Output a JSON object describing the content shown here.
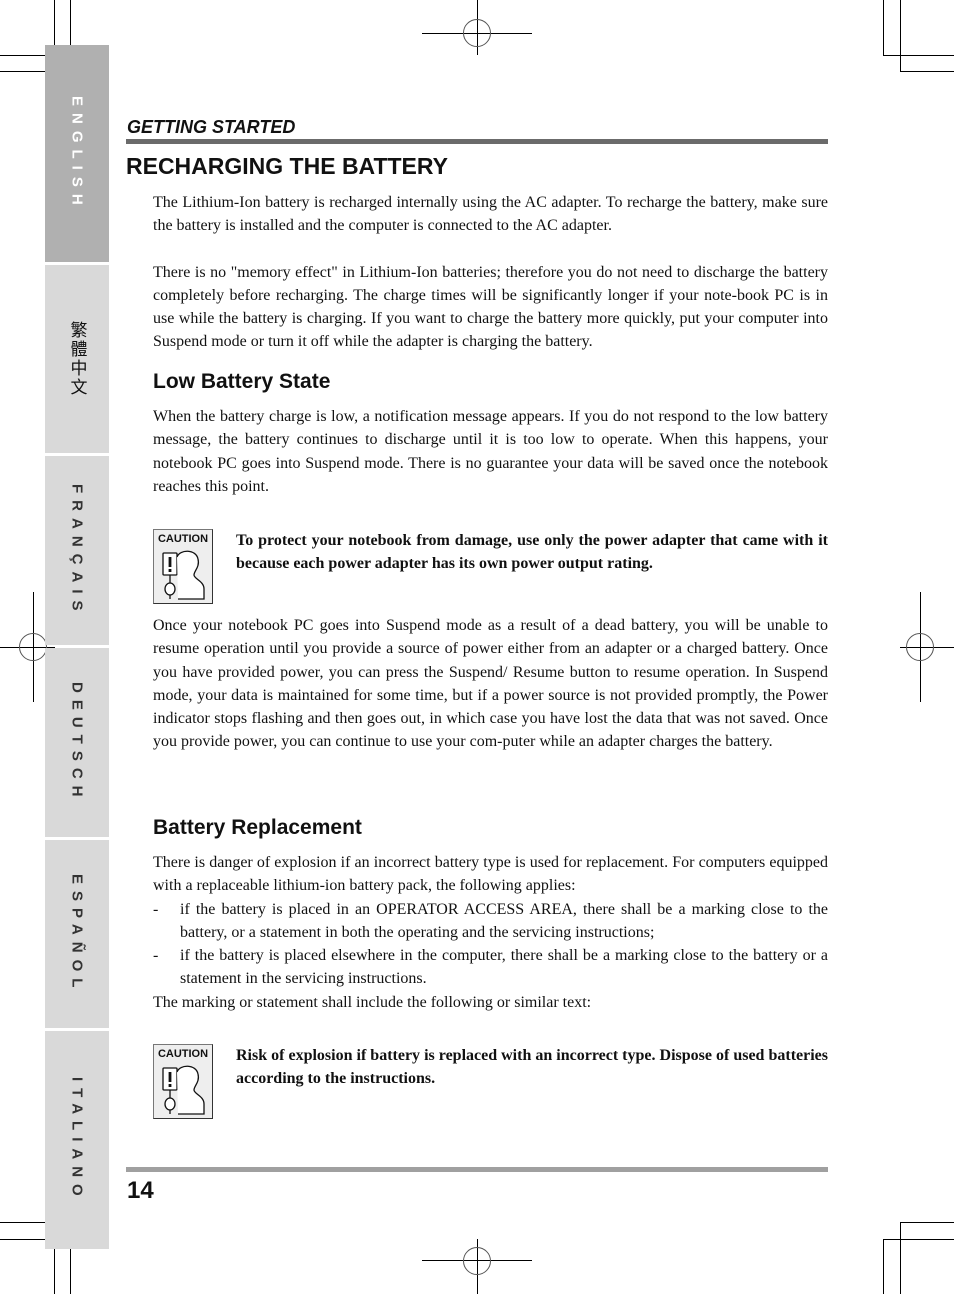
{
  "sidebar": {
    "languages": [
      {
        "label": "ENGLISH",
        "active": true
      },
      {
        "label": "繁體中文",
        "active": false
      },
      {
        "label": "FRANÇAIS",
        "active": false
      },
      {
        "label": "DEUTSCH",
        "active": false
      },
      {
        "label": "ESPAÑOL",
        "active": false
      },
      {
        "label": "ITALIANO",
        "active": false
      }
    ]
  },
  "header": {
    "section": "GETTING STARTED",
    "title": "RECHARGING THE BATTERY"
  },
  "recharging": {
    "paragraphs": [
      "The Lithium-Ion battery is recharged internally using the AC adapter. To recharge the battery, make sure the battery is installed and the computer is connected to the AC adapter.",
      "There is no \"memory effect\" in Lithium-Ion batteries; therefore you do not need to discharge the battery completely before recharging. The charge times will be significantly longer if your note-book PC is in use while the battery is charging. If you want to charge the battery more quickly, put your computer into Suspend mode or turn it off while the adapter is charging the battery."
    ]
  },
  "low_battery": {
    "heading": "Low Battery State",
    "paragraph": "When the battery charge is low, a notification message appears. If you do not respond to the low battery message, the battery continues to discharge until it is too low to operate. When this happens, your notebook PC goes into Suspend mode. There is no guarantee your data will be saved once the notebook reaches this point.",
    "caution": {
      "label": "CAUTION",
      "text": "To protect your notebook from damage, use only the power adapter that came with it because each power adapter has its own power output rating."
    },
    "paragraph2": "Once your notebook PC goes into Suspend mode as a result of a dead battery, you will be unable to resume operation until you provide a source of power either from an adapter or a charged battery. Once you have provided power, you can press the Suspend/ Resume button to resume operation. In Suspend mode, your data is maintained for some time, but if a power source is not provided promptly, the Power indicator stops flashing and then goes out, in which case you have lost the data that was not saved. Once you provide power, you can continue to use your com-puter while an adapter charges the battery."
  },
  "replacement": {
    "heading": "Battery Replacement",
    "intro": "There is danger of explosion if an incorrect battery type is used for replacement. For computers equipped with a replaceable lithium-ion battery pack, the following applies:",
    "bullets": [
      {
        "marker": "-",
        "text": "if the battery is placed in an OPERATOR ACCESS AREA, there shall be a marking close to the battery, or a statement in both the operating and the servicing instructions;"
      },
      {
        "marker": "-",
        "text": "if the battery is placed elsewhere in the computer, there shall be a marking close to the battery or a statement in the servicing instructions."
      }
    ],
    "outro": "The marking or statement shall include the following or similar text:",
    "caution": {
      "label": "CAUTION",
      "text": "Risk of explosion if battery is replaced with an incorrect type. Dispose of used batteries according to the instructions."
    }
  },
  "footer": {
    "page_number": "14"
  }
}
